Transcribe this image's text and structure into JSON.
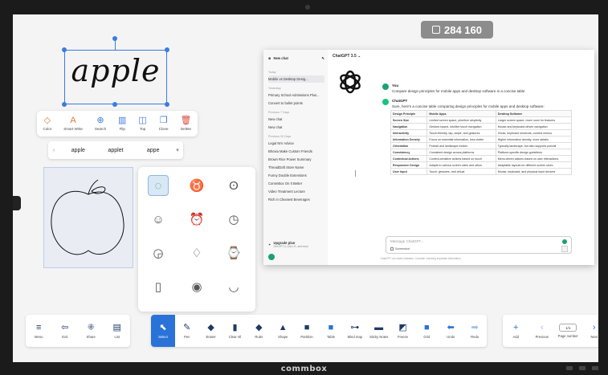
{
  "device": {
    "brand": "commbox"
  },
  "badge": {
    "value": "284 160",
    "icon": "id-card-icon"
  },
  "handwriting": {
    "text": "apple"
  },
  "handwriting_toolbar": {
    "items": [
      {
        "label": "Color",
        "icon": "color-drop-icon"
      },
      {
        "label": "Smart Write",
        "icon": "text-convert-icon"
      },
      {
        "label": "Search",
        "icon": "search-icon"
      },
      {
        "label": "Flip",
        "icon": "flip-icon"
      },
      {
        "label": "Top",
        "icon": "bring-to-top-icon"
      },
      {
        "label": "Clone",
        "icon": "clone-icon"
      },
      {
        "label": "Delete",
        "icon": "trash-icon"
      }
    ]
  },
  "suggestions": {
    "words": [
      "apple",
      "applet",
      "appe"
    ]
  },
  "shape_suggestions": {
    "icons": [
      "apple-outline",
      "apple-double",
      "apple-leaf",
      "apple-face",
      "alarm-clock",
      "clock-face",
      "alarm-clock-round",
      "water-drop",
      "watch",
      "smartwatch",
      "wristwatch",
      "watermelon-slice"
    ]
  },
  "chatgpt": {
    "model": "ChatGPT 3.5",
    "new_chat": "New chat",
    "sections": {
      "today": "Today",
      "yesterday": "Yesterday",
      "previous_7": "Previous 7 Days",
      "previous_30": "Previous 30 Days"
    },
    "history_today": [
      "Mobile vs Desktop Desig..."
    ],
    "history_yesterday": [
      "Primary School Admissions Plus...",
      "Convert to bullet points"
    ],
    "history_7": [
      "New chat",
      "New chat"
    ],
    "history_30": [
      "Legal NIV Advice",
      "Bhovia Make Custom Friends",
      "Brown Rice Power Summary",
      "ThreadDaft Store Name",
      "Funny Double Extensions",
      "CommBox On It Better",
      "Video Treatment Lecture",
      "Rich in Cleanest Beverages"
    ],
    "upgrade": {
      "title": "Upgrade plan",
      "subtitle": "Get GPT-4, DALL·E, and more"
    },
    "user_msg": {
      "name": "You",
      "text": "Compare design principles for mobile apps and desktop software in a concise table"
    },
    "bot_msg": {
      "name": "ChatGPT",
      "text": "Sure, here's a concise table comparing design principles for mobile apps and desktop software:"
    },
    "table": {
      "headers": [
        "Design Principle",
        "Mobile Apps",
        "Desktop Software"
      ],
      "rows": [
        [
          "Screen Size",
          "Limited screen space, prioritize simplicity",
          "Larger screen space, more room for features"
        ],
        [
          "Navigation",
          "Gesture-based, intuitive touch navigation",
          "Mouse and keyboard-driven navigation"
        ],
        [
          "Interactivity",
          "Touch-friendly, tap, swipe, and gestures",
          "Clicks, keyboard shortcuts, context menus"
        ],
        [
          "Information Density",
          "Focus on essential information, less clutter",
          "Higher information density, more details"
        ],
        [
          "Orientation",
          "Portrait and landscape modes",
          "Typically landscape, but also supports portrait"
        ],
        [
          "Consistency",
          "Consistent design across platforms",
          "Platform-specific design guidelines"
        ],
        [
          "Contextual Actions",
          "Context-sensitive actions based on touch",
          "Menu-driven actions based on user interactions"
        ],
        [
          "Responsive Design",
          "Adapts to various screen sizes and ratios",
          "Adaptable layouts for different screen sizes"
        ],
        [
          "User Input",
          "Touch, gestures, and virtual",
          "Mouse, keyboard, and physical input devices"
        ]
      ]
    },
    "input_placeholder": "Message ChatGPT...",
    "screenshot_label": "Screenshot",
    "footer": "ChatGPT can make mistakes. Consider checking important information."
  },
  "bottom_left": [
    {
      "label": "Menu",
      "icon": "menu-icon"
    },
    {
      "label": "Exit",
      "icon": "exit-icon"
    },
    {
      "label": "Share",
      "icon": "share-icon"
    },
    {
      "label": "List",
      "icon": "list-icon"
    }
  ],
  "bottom_center": [
    {
      "label": "Select",
      "icon": "select-cursor-icon",
      "selected": true
    },
    {
      "label": "Pen",
      "icon": "pen-icon"
    },
    {
      "label": "Eraser",
      "icon": "eraser-icon"
    },
    {
      "label": "Clear All",
      "icon": "clear-all-icon"
    },
    {
      "label": "Ruler",
      "icon": "ruler-icon"
    },
    {
      "label": "Shape",
      "icon": "shape-icon"
    },
    {
      "label": "Partition",
      "icon": "partition-icon"
    },
    {
      "label": "Table",
      "icon": "table-icon"
    },
    {
      "label": "Mind map",
      "icon": "mind-map-icon"
    },
    {
      "label": "Sticky Notes",
      "icon": "sticky-notes-icon"
    },
    {
      "label": "Freeze",
      "icon": "freeze-icon"
    },
    {
      "label": "Grid",
      "icon": "grid-icon"
    },
    {
      "label": "Undo",
      "icon": "undo-icon"
    },
    {
      "label": "Redo",
      "icon": "redo-icon"
    }
  ],
  "bottom_right": {
    "add": "Add",
    "previous": "Previous",
    "page": "1/1",
    "page_label": "Page number",
    "next": "Next"
  },
  "colors": {
    "accent": "#2a72d8",
    "selection": "#3d7be0",
    "toolbar_icon": "#1f3a66",
    "chatgpt_green": "#19c37d"
  }
}
